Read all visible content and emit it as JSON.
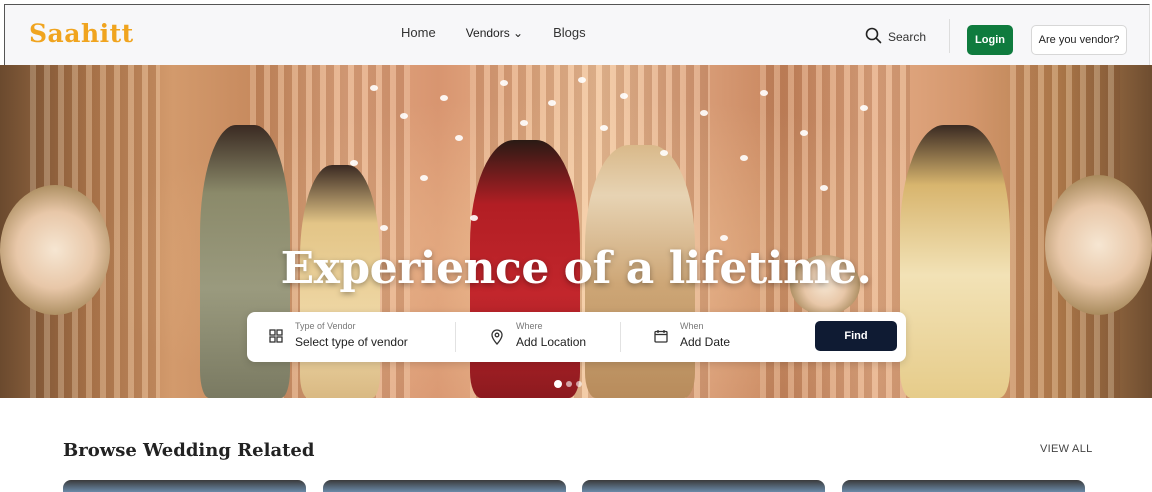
{
  "header": {
    "logo": "Saahitt",
    "nav": {
      "home": "Home",
      "vendors": "Vendors ⌄",
      "blogs": "Blogs"
    },
    "search_label": "Search",
    "login_label": "Login",
    "vendor_button_label": "Are you vendor?"
  },
  "hero": {
    "title": "Experience of a lifetime.",
    "search": {
      "vendor_type_label": "Type of Vendor",
      "vendor_type_value": "Select type of vendor",
      "where_label": "Where",
      "where_value": "Add Location",
      "when_label": "When",
      "when_value": "Add Date",
      "find_label": "Find"
    },
    "slide_count": 3,
    "active_slide": 1
  },
  "browse": {
    "title": "Browse Wedding Related",
    "view_all": "VIEW ALL"
  },
  "colors": {
    "logo": "#f0a41f",
    "login_button": "#0f7b3e",
    "find_button": "#0f1b33"
  }
}
